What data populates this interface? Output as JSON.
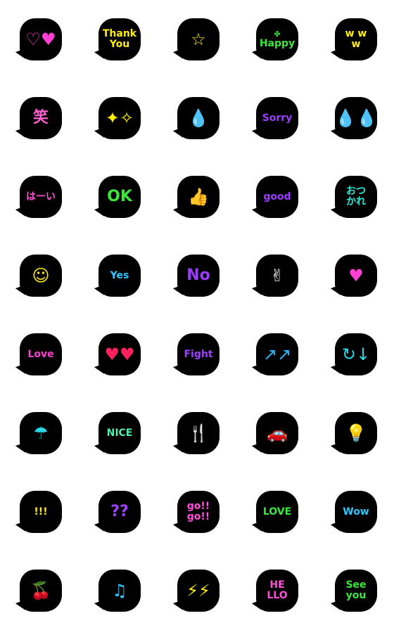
{
  "stickers": [
    {
      "icon": "hearts-icon",
      "glyph": "♡♥",
      "color": "#ff3fd2",
      "lines": []
    },
    {
      "icon": "hearts-icon",
      "glyph": "",
      "color": "#ffee00",
      "lines": [
        "Thank",
        "You"
      ]
    },
    {
      "icon": "shooting-star-icon",
      "glyph": "☆",
      "color": "#ffee00",
      "lines": []
    },
    {
      "icon": "clover-icon",
      "glyph": "✤",
      "color": "#39e83a",
      "lines": [
        "Happy"
      ]
    },
    {
      "icon": "w-laugh-icon",
      "glyph": "",
      "color": "#ffee00",
      "lines": [
        "w w",
        "w"
      ]
    },
    {
      "icon": "laugh-kanji-icon",
      "glyph": "",
      "color": "#ff5fd0",
      "lines": [
        "笑"
      ]
    },
    {
      "icon": "sparkles-icon",
      "glyph": "✦✧",
      "color": "#ffee00",
      "lines": []
    },
    {
      "icon": "drops-icon",
      "glyph": "💧",
      "color": "#2ab8ff",
      "lines": []
    },
    {
      "icon": "drops-icon",
      "glyph": "",
      "color": "#9b3cff",
      "lines": [
        "Sorry"
      ]
    },
    {
      "icon": "sweat-drops-icon",
      "glyph": "💧💧",
      "color": "#29d9e8",
      "lines": []
    },
    {
      "icon": "sparkles-icon",
      "glyph": "",
      "color": "#ff4fd8",
      "lines": [
        "はーい"
      ]
    },
    {
      "icon": "ok-icon",
      "glyph": "",
      "color": "#39e83a",
      "lines": [
        "OK"
      ]
    },
    {
      "icon": "thumbs-up-icon",
      "glyph": "👍",
      "color": "#ffffff",
      "lines": []
    },
    {
      "icon": "good-icon",
      "glyph": "",
      "color": "#9b3cff",
      "lines": [
        "good"
      ]
    },
    {
      "icon": "otsukare-icon",
      "glyph": "",
      "color": "#29e8d6",
      "lines": [
        "おつ",
        "かれ"
      ]
    },
    {
      "icon": "smiley-icon",
      "glyph": "☺",
      "color": "#ffee00",
      "lines": []
    },
    {
      "icon": "sparkles-icon",
      "glyph": "",
      "color": "#29c8ff",
      "lines": [
        "Yes"
      ]
    },
    {
      "icon": "drops-icon",
      "glyph": "",
      "color": "#9b3cff",
      "lines": [
        "No"
      ]
    },
    {
      "icon": "peace-hand-icon",
      "glyph": "✌",
      "color": "#ffffff",
      "lines": []
    },
    {
      "icon": "finger-heart-icon",
      "glyph": "♥",
      "color": "#ff3fd2",
      "lines": []
    },
    {
      "icon": "hearts-icon",
      "glyph": "",
      "color": "#ff3fd2",
      "lines": [
        "Love"
      ]
    },
    {
      "icon": "hearts-icon",
      "glyph": "♥♥",
      "color": "#ff2060",
      "lines": []
    },
    {
      "icon": "fight-icon",
      "glyph": "",
      "color": "#a040ff",
      "lines": [
        "Fight"
      ]
    },
    {
      "icon": "arrows-icon",
      "glyph": "↗↗",
      "color": "#2ab8ff",
      "lines": []
    },
    {
      "icon": "arrows-icon",
      "glyph": "↻↓",
      "color": "#29d9e8",
      "lines": []
    },
    {
      "icon": "umbrella-icon",
      "glyph": "☂",
      "color": "#29d9e8",
      "lines": []
    },
    {
      "icon": "nice-icon",
      "glyph": "",
      "color": "#4ff0b0",
      "lines": [
        "NICE"
      ]
    },
    {
      "icon": "fork-knife-icon",
      "glyph": "🍴",
      "color": "#ff4fd8",
      "lines": []
    },
    {
      "icon": "car-icon",
      "glyph": "🚗",
      "color": "#ffee00",
      "lines": []
    },
    {
      "icon": "light-bulb-icon",
      "glyph": "💡",
      "color": "#29d9e8",
      "lines": []
    },
    {
      "icon": "exclamation-icon",
      "glyph": "",
      "color": "#ffee00",
      "lines": [
        "!!!"
      ]
    },
    {
      "icon": "question-icon",
      "glyph": "",
      "color": "#a040ff",
      "lines": [
        "??"
      ]
    },
    {
      "icon": "go-icon",
      "glyph": "",
      "color": "#ff4fd8",
      "lines": [
        "go!!",
        "go!!"
      ]
    },
    {
      "icon": "heart-love-icon",
      "glyph": "",
      "color": "#39e83a",
      "lines": [
        "LOVE"
      ]
    },
    {
      "icon": "wow-icon",
      "glyph": "",
      "color": "#29c8ff",
      "lines": [
        "Wow"
      ]
    },
    {
      "icon": "cherry-icon",
      "glyph": "🍒",
      "color": "#ff2040",
      "lines": []
    },
    {
      "icon": "music-note-icon",
      "glyph": "♫",
      "color": "#29c8ff",
      "lines": []
    },
    {
      "icon": "lightning-icon",
      "glyph": "⚡⚡",
      "color": "#ffee00",
      "lines": []
    },
    {
      "icon": "smartphone-icon",
      "glyph": "",
      "color": "#ff4fd8",
      "lines": [
        "HE",
        "LLO"
      ]
    },
    {
      "icon": "see-you-icon",
      "glyph": "",
      "color": "#39e83a",
      "lines": [
        "See",
        "you"
      ]
    }
  ]
}
